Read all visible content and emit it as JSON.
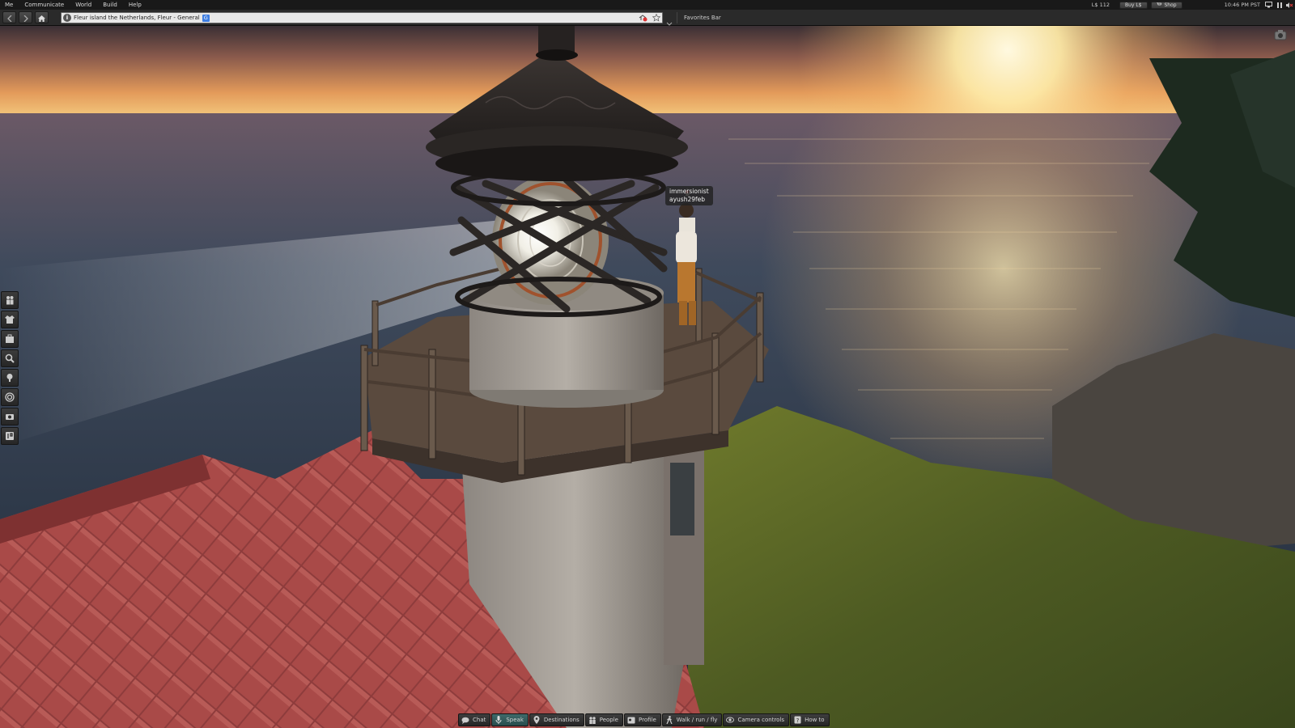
{
  "menubar": {
    "items": [
      "Me",
      "Communicate",
      "World",
      "Build",
      "Help"
    ],
    "balance": "L$ 112",
    "buy_label": "Buy L$",
    "shop_label": "Shop",
    "time": "10:46 PM PST"
  },
  "navbar": {
    "location": "Fleur  island  the Netherlands, Fleur - General",
    "location_badge": "G",
    "favorites_label": "Favorites Bar"
  },
  "scene": {
    "avatar_name_line1": "immersionist",
    "avatar_name_line2": "ayush29feb"
  },
  "left_toolbar": {
    "icons": [
      "people-icon",
      "appearance-icon",
      "inventory-icon",
      "search-icon",
      "places-icon",
      "radar-icon",
      "snapshot-icon",
      "map-icon"
    ]
  },
  "bottom_toolbar": {
    "buttons": [
      {
        "label": "Chat",
        "icon": "chat-icon"
      },
      {
        "label": "Speak",
        "icon": "microphone-icon"
      },
      {
        "label": "Destinations",
        "icon": "destinations-icon"
      },
      {
        "label": "People",
        "icon": "people-icon"
      },
      {
        "label": "Profile",
        "icon": "profile-icon"
      },
      {
        "label": "Walk / run / fly",
        "icon": "walk-icon"
      },
      {
        "label": "Camera controls",
        "icon": "camera-icon"
      },
      {
        "label": "How to",
        "icon": "howto-icon"
      }
    ]
  },
  "colors": {
    "speak_active": "#2f5a5a",
    "toolbar_bg": "#2a2a2a",
    "location_badge": "#3e7ee2"
  }
}
